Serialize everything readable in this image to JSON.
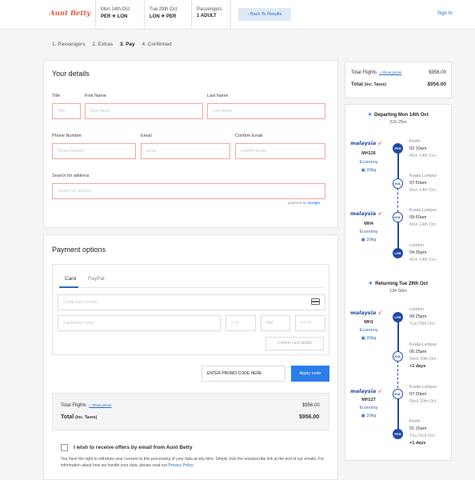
{
  "header": {
    "logo": "Aunt Betty",
    "depart_label": "Mon 14th Oct",
    "depart_route": "PER ✈ LON",
    "return_label": "Tue 29th Oct",
    "return_route": "LON ✈ PER",
    "pax_label": "Passengers",
    "pax_value": "1 ADULT",
    "back_button": "Back To Results",
    "sign_in": "Sign In"
  },
  "steps": [
    "1. Passengers",
    "2. Extras",
    "3. Pay",
    "4. Confirmed"
  ],
  "details": {
    "title": "Your details",
    "title_label": "Title",
    "title_placeholder": "Title",
    "first_label": "First Name",
    "first_placeholder": "First Name",
    "last_label": "Last Name",
    "last_placeholder": "Last Name",
    "phone_label": "Phone Number",
    "phone_placeholder": "Phone Number",
    "email_label": "Email",
    "email_placeholder": "Email",
    "confirm_label": "Confirm Email",
    "confirm_placeholder": "Confirm Email",
    "address_label": "Search for address",
    "address_placeholder": "Search for address",
    "powered_prefix": "powered by",
    "powered_brand": "Google"
  },
  "payment": {
    "title": "Payment options",
    "tab_card": "Card",
    "tab_paypal": "PayPal",
    "card_number_placeholder": "Credit card number",
    "card_name_placeholder": "Cardholder name",
    "cvv_placeholder": "CVV",
    "mm_placeholder": "MM",
    "yyyy_placeholder": "YYYY",
    "confirm_button": "Confirm card details",
    "promo_value": "ENTER PROMO CODE HERE",
    "apply_button": "Apply code"
  },
  "summary": {
    "flights_label": "Total Flights",
    "show_prices": "+ Show prices",
    "flights_value": "$956.00",
    "total_label": "Total",
    "total_suffix": "(inc. Taxes)",
    "total_value": "$956.00"
  },
  "offers": {
    "label": "I wish to receive offers by email from Aunt Betty",
    "consent": "You have the right to withdraw your consent to this processing of your data at any time. Simply click the unsubscribe link at the end of our emails. For information about how we handle your data, please read our",
    "policy_link": "Privacy Policy"
  },
  "itinerary": {
    "departing": {
      "title": "Departing Mon 14th Oct",
      "duration": "21h 25m",
      "segments": [
        {
          "airline": "malaysia",
          "flight": "MH126",
          "class": "Economy",
          "bag": "20kg"
        },
        {
          "airline": "malaysia",
          "flight": "MH4",
          "class": "Economy",
          "bag": "20kg"
        }
      ],
      "stops": [
        {
          "code": "PER",
          "city": "Perth",
          "time": "02:10am",
          "date": "Mon 14th Oct"
        },
        {
          "code": "KUL",
          "city": "Kuala Lumpur",
          "time": "07:50am",
          "date": "Mon 14th Oct"
        },
        {
          "code": "KUL",
          "city": "Kuala Lumpur",
          "time": "09:50am",
          "date": "Mon 14th Oct"
        },
        {
          "code": "LHR",
          "city": "London",
          "time": "04:35pm",
          "date": "Mon 14th Oct"
        }
      ]
    },
    "returning": {
      "title": "Returning Tue 29th Oct",
      "duration": "19h 50m",
      "segments": [
        {
          "airline": "malaysia",
          "flight": "MH1",
          "class": "Economy",
          "bag": "20kg"
        },
        {
          "airline": "malaysia",
          "flight": "MH127",
          "class": "Economy",
          "bag": "20kg"
        }
      ],
      "stops": [
        {
          "code": "LHR",
          "city": "London",
          "time": "09:25pm",
          "date": "Tue 29th Oct",
          "plus": ""
        },
        {
          "code": "KUL",
          "city": "Kuala Lumpur",
          "time": "06:25pm",
          "date": "Wed 30th Oct",
          "plus": "+1 days"
        },
        {
          "code": "KUL",
          "city": "Kuala Lumpur",
          "time": "07:30pm",
          "date": "Wed 30th Oct",
          "plus": ""
        },
        {
          "code": "PER",
          "city": "Perth",
          "time": "01:15am",
          "date": "Thu 31st Oct",
          "plus": "+1 days"
        }
      ]
    }
  },
  "colors": {
    "brand": "#e8573f",
    "accent": "#2b7de9",
    "link": "#2b6bb8",
    "airline": "#1f4aa5"
  }
}
